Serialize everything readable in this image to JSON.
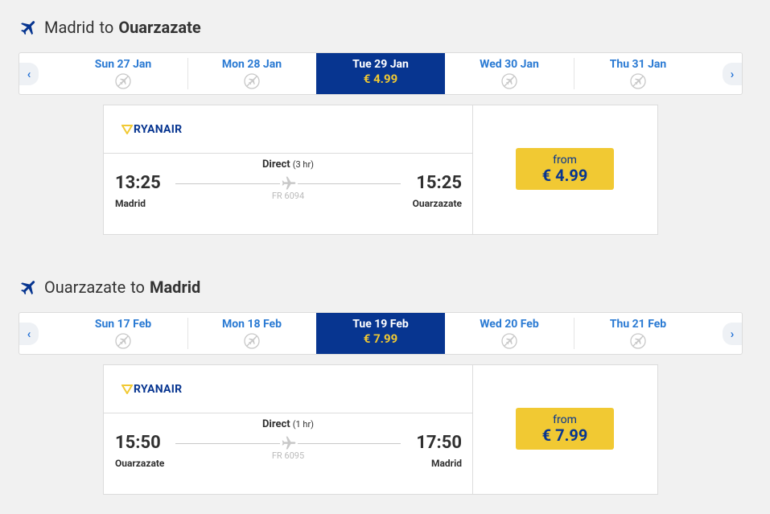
{
  "outbound": {
    "origin": "Madrid",
    "to_word": "to",
    "destination": "Ouarzazate",
    "dates": [
      {
        "label": "Sun 27 Jan"
      },
      {
        "label": "Mon 28 Jan"
      },
      {
        "label": "Tue 29 Jan",
        "price": "€ 4.99",
        "selected": true
      },
      {
        "label": "Wed 30 Jan"
      },
      {
        "label": "Thu 31 Jan"
      }
    ],
    "flight": {
      "airline": "RYANAIR",
      "dep_time": "13:25",
      "dep_city": "Madrid",
      "arr_time": "15:25",
      "arr_city": "Ouarzazate",
      "stops": "Direct",
      "duration": "(3 hr)",
      "flight_number": "FR 6094",
      "from_label": "from",
      "price": "€ 4.99"
    }
  },
  "return": {
    "origin": "Ouarzazate",
    "to_word": "to",
    "destination": "Madrid",
    "dates": [
      {
        "label": "Sun 17 Feb"
      },
      {
        "label": "Mon 18 Feb"
      },
      {
        "label": "Tue 19 Feb",
        "price": "€ 7.99",
        "selected": true
      },
      {
        "label": "Wed 20 Feb"
      },
      {
        "label": "Thu 21 Feb"
      }
    ],
    "flight": {
      "airline": "RYANAIR",
      "dep_time": "15:50",
      "dep_city": "Ouarzazate",
      "arr_time": "17:50",
      "arr_city": "Madrid",
      "stops": "Direct",
      "duration": "(1 hr)",
      "flight_number": "FR 6095",
      "from_label": "from",
      "price": "€ 7.99"
    }
  },
  "colors": {
    "brand_blue": "#073590",
    "accent_yellow": "#f1c933",
    "link_blue": "#2a7ad3",
    "background": "#f1f1f1"
  },
  "icons": {
    "title": "airplane-icon",
    "no_flight": "no-flight-icon",
    "prev": "chevron-left-icon",
    "next": "chevron-right-icon",
    "logo": "ryanair-harp-logo"
  }
}
